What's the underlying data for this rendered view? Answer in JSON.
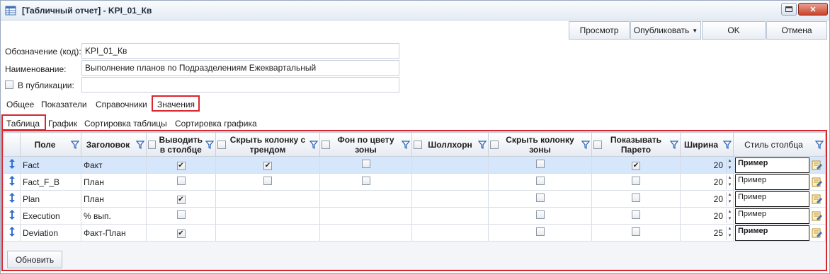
{
  "window": {
    "title": "[Табличный отчет] - KPI_01_Кв"
  },
  "toolbar": {
    "preview": "Просмотр",
    "publish": "Опубликовать",
    "ok": "OK",
    "cancel": "Отмена"
  },
  "form": {
    "code_label": "Обозначение (код):",
    "code_value": "KPI_01_Кв",
    "name_label": "Наименование:",
    "name_value": "Выполнение планов по Подразделениям Ежеквартальный",
    "publish_label": "В публикации:",
    "publish_checked": false,
    "publish_value": ""
  },
  "tabs": [
    "Общее",
    "Показатели",
    "Справочники",
    "Значения"
  ],
  "active_tab": "Значения",
  "subtabs": [
    "Таблица",
    "График",
    "Сортировка таблицы",
    "Сортировка графика"
  ],
  "active_subtab": "Таблица",
  "grid": {
    "columns": [
      {
        "label": "Поле",
        "checkbox": false
      },
      {
        "label": "Заголовок",
        "checkbox": false
      },
      {
        "label": "Выводить в столбце",
        "checkbox": true
      },
      {
        "label": "Скрыть колонку с трендом",
        "checkbox": true
      },
      {
        "label": "Фон по цвету зоны",
        "checkbox": true
      },
      {
        "label": "Шоллхорн",
        "checkbox": true
      },
      {
        "label": "Скрыть колонку зоны",
        "checkbox": true
      },
      {
        "label": "Показывать Парето",
        "checkbox": true
      },
      {
        "label": "Ширина",
        "checkbox": false
      },
      {
        "label": "Стиль столбца",
        "checkbox": false
      }
    ],
    "rows": [
      {
        "field": "Fact",
        "header": "Факт",
        "show": true,
        "hide_trend": true,
        "zone_bg": false,
        "shollhorn": null,
        "hide_zone": false,
        "pareto": true,
        "width": "20",
        "style": "Пример",
        "style_bold": true,
        "selected": true
      },
      {
        "field": "Fact_F_B",
        "header": "План",
        "show": false,
        "hide_trend": false,
        "zone_bg": false,
        "shollhorn": null,
        "hide_zone": false,
        "pareto": false,
        "width": "20",
        "style": "Пример",
        "style_bold": false,
        "selected": false
      },
      {
        "field": "Plan",
        "header": "План",
        "show": true,
        "hide_trend": null,
        "zone_bg": null,
        "shollhorn": null,
        "hide_zone": false,
        "pareto": false,
        "width": "20",
        "style": "Пример",
        "style_bold": false,
        "selected": false
      },
      {
        "field": "Execution",
        "header": "% вып.",
        "show": false,
        "hide_trend": null,
        "zone_bg": null,
        "shollhorn": null,
        "hide_zone": false,
        "pareto": false,
        "width": "20",
        "style": "Пример",
        "style_bold": false,
        "selected": false
      },
      {
        "field": "Deviation",
        "header": "Факт-План",
        "show": true,
        "hide_trend": null,
        "zone_bg": null,
        "shollhorn": null,
        "hide_zone": false,
        "pareto": false,
        "width": "25",
        "style": "Пример",
        "style_bold": true,
        "selected": false
      }
    ]
  },
  "refresh_button": "Обновить",
  "colors": {
    "highlight_border": "#d7262e",
    "selected_row": "#d6e6fb",
    "drag_icon": "#2f6fcf",
    "filter_icon": "#2a62b8"
  }
}
